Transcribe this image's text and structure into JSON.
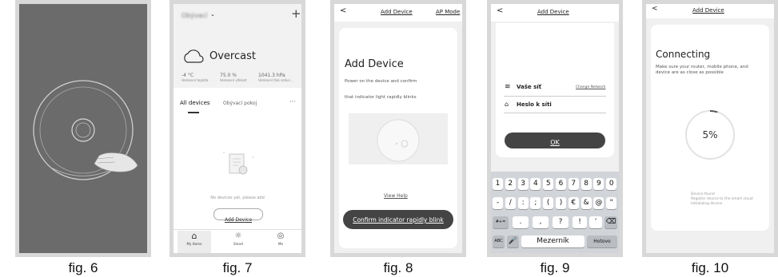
{
  "fig6": {
    "caption": "fig. 6"
  },
  "fig7": {
    "caption": "fig. 7",
    "home_name": "Obývací",
    "weather": "Overcast",
    "stats": [
      {
        "value": "-4 °C",
        "label": "Venkovní teplota"
      },
      {
        "value": "75.0 %",
        "label": "Venkovní vlhkost"
      },
      {
        "value": "1041.3 hPa",
        "label": "Venkovní tlak vzduc..."
      }
    ],
    "tabs": [
      "All devices",
      "Obývací pokoj"
    ],
    "more": "···",
    "add_icon": "+",
    "empty_text": "No devices yet, please add",
    "add_device_button": "Add Device",
    "nav": [
      {
        "label": "My Home",
        "icon": "home-icon"
      },
      {
        "label": "Smart",
        "icon": "sun-icon"
      },
      {
        "label": "Me",
        "icon": "user-icon"
      }
    ]
  },
  "fig8": {
    "caption": "fig. 8",
    "back": "<",
    "header_title": "Add Device",
    "header_right": "AP Mode",
    "title": "Add Device",
    "line1": "Power on the device and confirm",
    "line2": "that indicator light rapidly blinks",
    "view_help": "View Help",
    "confirm_button": "Confirm indicator rapidly blink"
  },
  "fig9": {
    "caption": "fig. 9",
    "back": "<",
    "header_title": "Add Device",
    "wifi_name": "Vaše síť",
    "change_network": "Change Network",
    "password_label": "Heslo k síti",
    "ok_button": "OK",
    "row1": [
      "1",
      "2",
      "3",
      "4",
      "5",
      "6",
      "7",
      "8",
      "9",
      "0"
    ],
    "row2": [
      "-",
      "/",
      ":",
      ";",
      "(",
      ")",
      "€",
      "&",
      "@",
      "\""
    ],
    "row3": [
      "#+=",
      ".",
      ",",
      "?",
      "!",
      "’",
      "⌫"
    ],
    "row4": [
      "ABC",
      "🎤",
      "Mezerník",
      "Hotovo"
    ]
  },
  "fig10": {
    "caption": "fig. 10",
    "back": "<",
    "header_title": "Add Device",
    "title": "Connecting",
    "subtitle": "Make sure your router, mobile phone, and device are as close as possible",
    "progress_text": "5%",
    "progress_value": 5,
    "status": [
      "Device found",
      "Register device to the smart cloud",
      "Initializing device"
    ]
  }
}
